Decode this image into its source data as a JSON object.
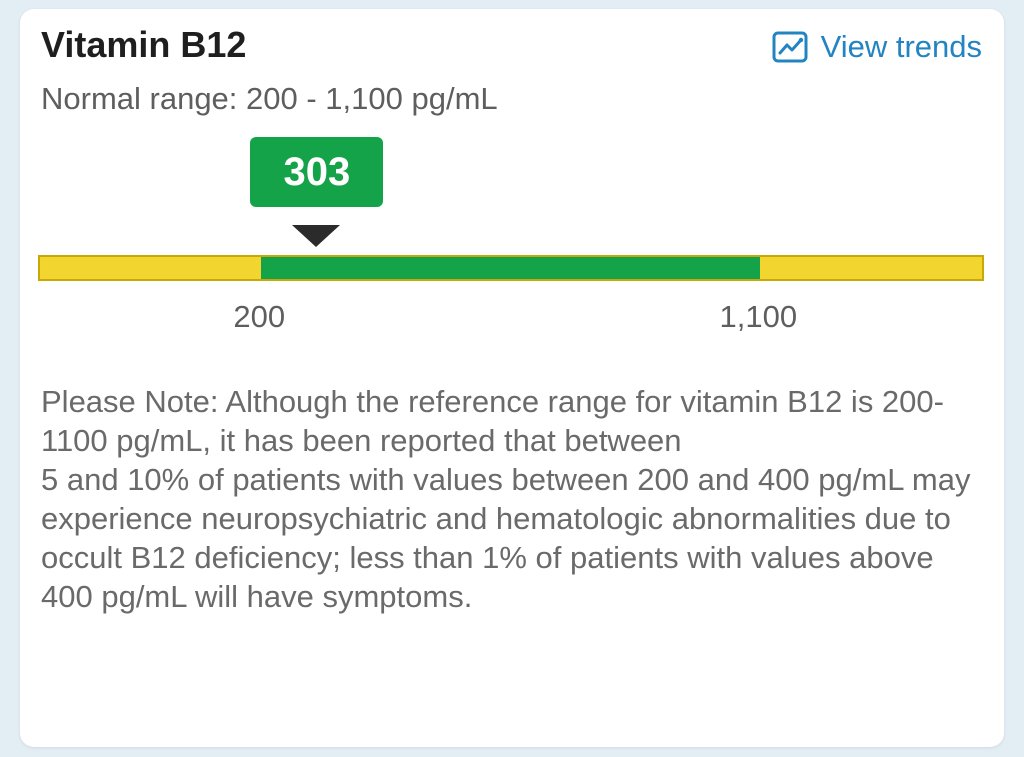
{
  "card": {
    "title": "Vitamin B12",
    "view_trends_label": "View trends",
    "trends_icon": "line-chart-icon",
    "normal_range_text": "Normal range: 200 - 1,100 pg/mL"
  },
  "gauge": {
    "value": 303,
    "value_text": "303",
    "normal_low": 200,
    "normal_high": 1100,
    "normal_low_label": "200",
    "normal_high_label": "1,100",
    "scale_min": -199,
    "scale_max": 1507,
    "colors": {
      "normal": "#15a34a",
      "out_of_range": "#f3d52f",
      "link": "#2384c2"
    }
  },
  "note": {
    "text": "Please Note: Although the reference range for vitamin B12 is 200-1100 pg/mL, it has been reported that between\n5 and 10% of patients with values between 200 and 400 pg/mL may experience neuropsychiatric and hematologic abnormalities due to occult B12 deficiency; less than 1% of patients with values above 400 pg/mL will have symptoms."
  }
}
